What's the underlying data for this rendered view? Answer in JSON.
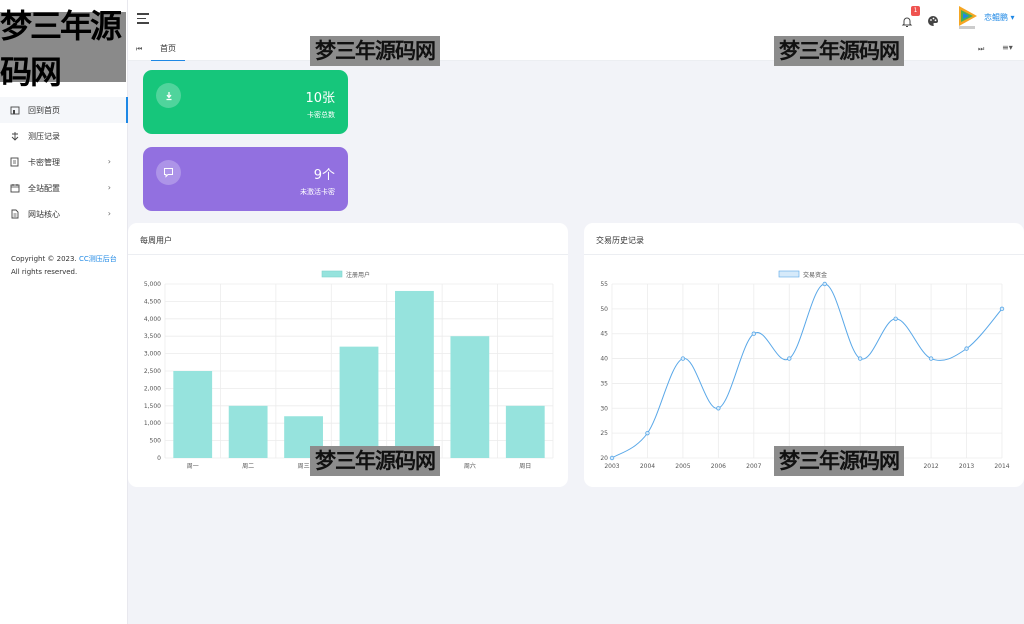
{
  "sidebar": {
    "logo_text": "梦三年源码网",
    "items": [
      {
        "label": "回到首页",
        "icon": "home-icon",
        "active": true,
        "has_submenu": false
      },
      {
        "label": "测压记录",
        "icon": "record-icon",
        "active": false,
        "has_submenu": false
      },
      {
        "label": "卡密管理",
        "icon": "card-icon",
        "active": false,
        "has_submenu": true
      },
      {
        "label": "全站配置",
        "icon": "config-icon",
        "active": false,
        "has_submenu": true
      },
      {
        "label": "网站核心",
        "icon": "file-icon",
        "active": false,
        "has_submenu": true
      }
    ],
    "chevron": "›",
    "copyright_prefix": "Copyright © 2023.",
    "copyright_link": "CC测压后台",
    "copyright_suffix": "All rights reserved."
  },
  "topbar": {
    "notification_count": "1",
    "username": "恋鲲鹏",
    "username_caret": "▾"
  },
  "tabs": {
    "prev_symbol": "⏮",
    "home_label": "首页",
    "next_symbol": "⏭",
    "menu_symbol": "≡▾"
  },
  "stats": [
    {
      "value": "10张",
      "label": "卡密总数",
      "color": "#16c67b",
      "icon": "download-icon"
    },
    {
      "value": "9个",
      "label": "未激活卡密",
      "color": "#9270e0",
      "icon": "message-icon"
    }
  ],
  "bar_panel": {
    "title": "每周用户"
  },
  "line_panel": {
    "title": "交易历史记录"
  },
  "chart_data": [
    {
      "type": "bar",
      "legend": [
        "注册用户"
      ],
      "categories": [
        "周一",
        "周二",
        "周三",
        "周四",
        "周五",
        "周六",
        "周日"
      ],
      "series": [
        {
          "name": "注册用户",
          "values": [
            2500,
            1500,
            1200,
            3200,
            4800,
            3500,
            1500
          ]
        }
      ],
      "ylim": [
        0,
        5000
      ],
      "yticks": [
        "0",
        "500",
        "1,000",
        "1,500",
        "2,000",
        "2,500",
        "3,000",
        "3,500",
        "4,000",
        "4,500",
        "5,000"
      ],
      "color": "#96e3dd",
      "grid": true,
      "legend_position": "top-center"
    },
    {
      "type": "line",
      "legend": [
        "交易资金"
      ],
      "x": [
        "2003",
        "2004",
        "2005",
        "2006",
        "2007",
        "2008",
        "2009",
        "2010",
        "2011",
        "2012",
        "2013",
        "2014"
      ],
      "series": [
        {
          "name": "交易资金",
          "values": [
            20,
            25,
            40,
            30,
            45,
            40,
            55,
            40,
            48,
            40,
            42,
            50
          ]
        }
      ],
      "ylim": [
        20,
        55
      ],
      "yticks": [
        "20",
        "25",
        "30",
        "35",
        "40",
        "45",
        "50",
        "55"
      ],
      "color": "#5aa8e8",
      "grid": true,
      "legend_position": "top-center"
    }
  ],
  "watermark": "梦三年源码网"
}
